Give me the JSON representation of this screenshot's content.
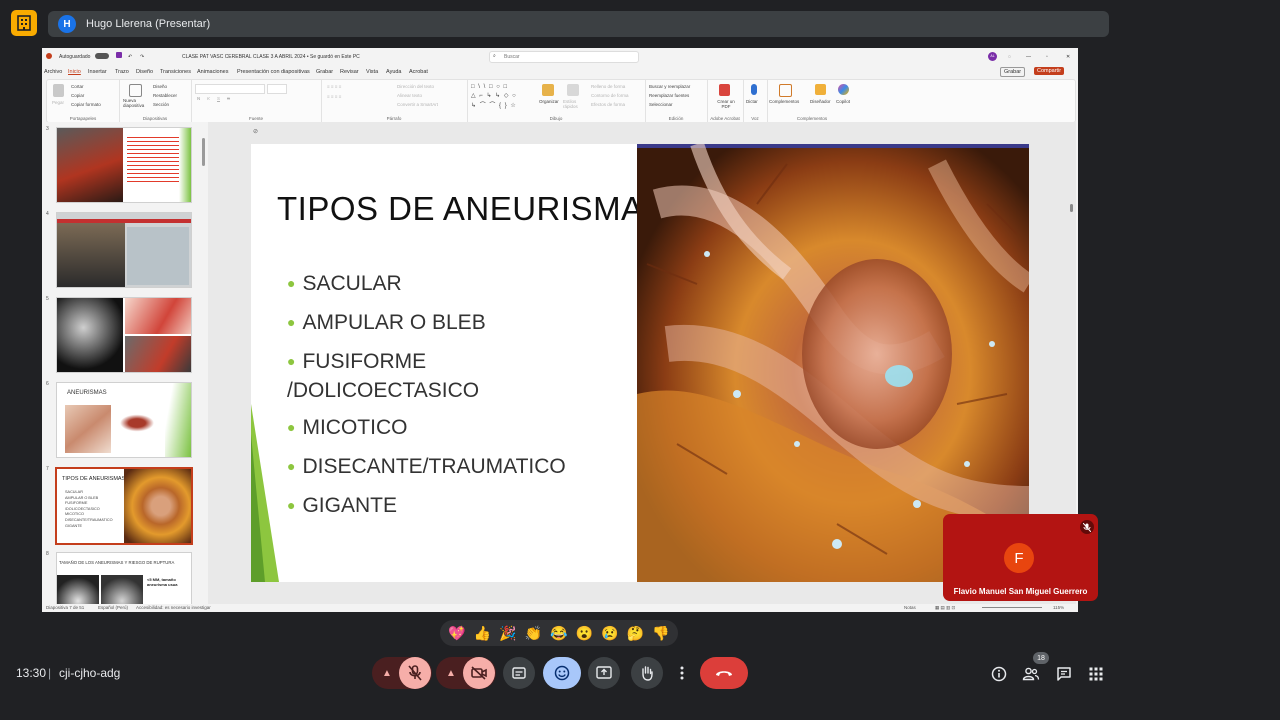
{
  "meet": {
    "presenter_initial": "H",
    "presenter_label": "Hugo Llerena (Presentar)",
    "time": "13:30",
    "separator": "|",
    "meeting_code": "cji-cjho-adg",
    "participant_count": "18",
    "reactions": [
      "💖",
      "👍",
      "🎉",
      "👏",
      "😂",
      "😮",
      "😢",
      "🤔",
      "👎"
    ],
    "participant_tile": {
      "initial": "F",
      "name": "Flavio Manuel San Miguel Guerrero"
    }
  },
  "ppt": {
    "autosave": "Autoguardado",
    "doc_title": "CLASE PAT VASC CEREBRAL CLASE 3 A ABRIL 2024 • Se guardó en Este PC",
    "search_placeholder": "Buscar",
    "user_initials": "AL",
    "record_label": "Grabar",
    "share_label": "Compartir",
    "menu": [
      "Archivo",
      "Inicio",
      "Insertar",
      "Trazo",
      "Diseño",
      "Transiciones",
      "Animaciones",
      "Presentación con diapositivas",
      "Grabar",
      "Revisar",
      "Vista",
      "Ayuda",
      "Acrobat"
    ],
    "ribbon": {
      "clipboard": {
        "paste": "Pegar",
        "cut": "Cortar",
        "copy": "Copiar",
        "format": "Copiar formato",
        "label": "Portapapeles"
      },
      "slides": {
        "new": "Nueva diapositiva",
        "layout": "Diseño",
        "reset": "Restablecer",
        "section": "Sección",
        "label": "Diapositivas"
      },
      "font": {
        "label": "Fuente",
        "bold": "N",
        "italic": "K",
        "underline": "S",
        "strike": "S"
      },
      "paragraph": {
        "direction": "Dirección del texto",
        "align": "Alinear texto",
        "smartart": "Convertir a SmartArt",
        "label": "Párrafo"
      },
      "drawing": {
        "arrange": "Organizar",
        "quick_styles": "Estilos rápidos",
        "fill": "Relleno de forma",
        "outline": "Contorno de forma",
        "effects": "Efectos de forma",
        "label": "Dibujo"
      },
      "editing": {
        "find": "Buscar y reemplazar",
        "replace": "Reemplazar fuentes",
        "select": "Seleccionar",
        "label": "Edición"
      },
      "acrobat": {
        "create_pdf": "Crear un PDF",
        "label": "Adobe Acrobat"
      },
      "voice": {
        "dictate": "Dictar",
        "label": "Voz"
      },
      "addins": {
        "addins": "Complementos",
        "designer": "Diseñador",
        "copilot": "Copilot",
        "label": "Complementos"
      }
    },
    "thumbnails": [
      {
        "num": "3"
      },
      {
        "num": "4"
      },
      {
        "num": "5"
      },
      {
        "num": "6",
        "title": "ANEURISMAS"
      },
      {
        "num": "7",
        "title": "TIPOS DE ANEURISMAS",
        "items": [
          "SACULAR",
          "AMPULAR O BLEB",
          "FUSIFORME",
          "/DOLICOECTASICO",
          "MICOTICO",
          "DISECANTE/TRAUMATICO",
          "GIGANTE"
        ]
      },
      {
        "num": "8",
        "title": "TAMAÑO DE LOS ANEURISMAS Y RIESGO DE RUPTURA",
        "caption": "<5 MM, tamaño aneurisma usua"
      }
    ],
    "slide": {
      "title": "TIPOS DE ANEURISMAS",
      "bullets": [
        "SACULAR",
        "AMPULAR O BLEB",
        "FUSIFORME /DOLICOECTASICO",
        "MICOTICO",
        "DISECANTE/TRAUMATICO",
        "GIGANTE"
      ]
    },
    "status": {
      "slide_of": "Diapositiva 7 de 51",
      "language": "Español (Perú)",
      "accessibility": "Accesibilidad: es necesario investigar",
      "notes": "Notas",
      "zoom": "115%"
    },
    "accent_color": "#c43e1c",
    "bullet_color": "#8dc63f"
  }
}
